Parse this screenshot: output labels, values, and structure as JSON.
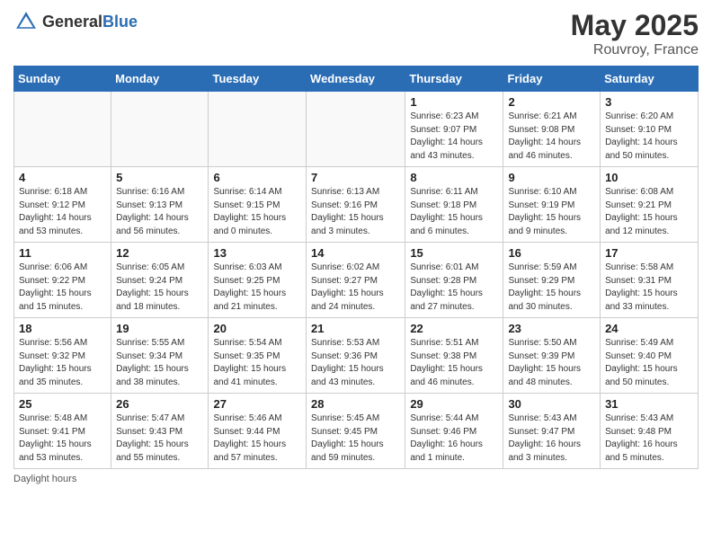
{
  "header": {
    "logo_general": "General",
    "logo_blue": "Blue",
    "main_title": "May 2025",
    "subtitle": "Rouvroy, France"
  },
  "weekdays": [
    "Sunday",
    "Monday",
    "Tuesday",
    "Wednesday",
    "Thursday",
    "Friday",
    "Saturday"
  ],
  "weeks": [
    [
      {
        "day": "",
        "info": ""
      },
      {
        "day": "",
        "info": ""
      },
      {
        "day": "",
        "info": ""
      },
      {
        "day": "",
        "info": ""
      },
      {
        "day": "1",
        "info": "Sunrise: 6:23 AM\nSunset: 9:07 PM\nDaylight: 14 hours and 43 minutes."
      },
      {
        "day": "2",
        "info": "Sunrise: 6:21 AM\nSunset: 9:08 PM\nDaylight: 14 hours and 46 minutes."
      },
      {
        "day": "3",
        "info": "Sunrise: 6:20 AM\nSunset: 9:10 PM\nDaylight: 14 hours and 50 minutes."
      }
    ],
    [
      {
        "day": "4",
        "info": "Sunrise: 6:18 AM\nSunset: 9:12 PM\nDaylight: 14 hours and 53 minutes."
      },
      {
        "day": "5",
        "info": "Sunrise: 6:16 AM\nSunset: 9:13 PM\nDaylight: 14 hours and 56 minutes."
      },
      {
        "day": "6",
        "info": "Sunrise: 6:14 AM\nSunset: 9:15 PM\nDaylight: 15 hours and 0 minutes."
      },
      {
        "day": "7",
        "info": "Sunrise: 6:13 AM\nSunset: 9:16 PM\nDaylight: 15 hours and 3 minutes."
      },
      {
        "day": "8",
        "info": "Sunrise: 6:11 AM\nSunset: 9:18 PM\nDaylight: 15 hours and 6 minutes."
      },
      {
        "day": "9",
        "info": "Sunrise: 6:10 AM\nSunset: 9:19 PM\nDaylight: 15 hours and 9 minutes."
      },
      {
        "day": "10",
        "info": "Sunrise: 6:08 AM\nSunset: 9:21 PM\nDaylight: 15 hours and 12 minutes."
      }
    ],
    [
      {
        "day": "11",
        "info": "Sunrise: 6:06 AM\nSunset: 9:22 PM\nDaylight: 15 hours and 15 minutes."
      },
      {
        "day": "12",
        "info": "Sunrise: 6:05 AM\nSunset: 9:24 PM\nDaylight: 15 hours and 18 minutes."
      },
      {
        "day": "13",
        "info": "Sunrise: 6:03 AM\nSunset: 9:25 PM\nDaylight: 15 hours and 21 minutes."
      },
      {
        "day": "14",
        "info": "Sunrise: 6:02 AM\nSunset: 9:27 PM\nDaylight: 15 hours and 24 minutes."
      },
      {
        "day": "15",
        "info": "Sunrise: 6:01 AM\nSunset: 9:28 PM\nDaylight: 15 hours and 27 minutes."
      },
      {
        "day": "16",
        "info": "Sunrise: 5:59 AM\nSunset: 9:29 PM\nDaylight: 15 hours and 30 minutes."
      },
      {
        "day": "17",
        "info": "Sunrise: 5:58 AM\nSunset: 9:31 PM\nDaylight: 15 hours and 33 minutes."
      }
    ],
    [
      {
        "day": "18",
        "info": "Sunrise: 5:56 AM\nSunset: 9:32 PM\nDaylight: 15 hours and 35 minutes."
      },
      {
        "day": "19",
        "info": "Sunrise: 5:55 AM\nSunset: 9:34 PM\nDaylight: 15 hours and 38 minutes."
      },
      {
        "day": "20",
        "info": "Sunrise: 5:54 AM\nSunset: 9:35 PM\nDaylight: 15 hours and 41 minutes."
      },
      {
        "day": "21",
        "info": "Sunrise: 5:53 AM\nSunset: 9:36 PM\nDaylight: 15 hours and 43 minutes."
      },
      {
        "day": "22",
        "info": "Sunrise: 5:51 AM\nSunset: 9:38 PM\nDaylight: 15 hours and 46 minutes."
      },
      {
        "day": "23",
        "info": "Sunrise: 5:50 AM\nSunset: 9:39 PM\nDaylight: 15 hours and 48 minutes."
      },
      {
        "day": "24",
        "info": "Sunrise: 5:49 AM\nSunset: 9:40 PM\nDaylight: 15 hours and 50 minutes."
      }
    ],
    [
      {
        "day": "25",
        "info": "Sunrise: 5:48 AM\nSunset: 9:41 PM\nDaylight: 15 hours and 53 minutes."
      },
      {
        "day": "26",
        "info": "Sunrise: 5:47 AM\nSunset: 9:43 PM\nDaylight: 15 hours and 55 minutes."
      },
      {
        "day": "27",
        "info": "Sunrise: 5:46 AM\nSunset: 9:44 PM\nDaylight: 15 hours and 57 minutes."
      },
      {
        "day": "28",
        "info": "Sunrise: 5:45 AM\nSunset: 9:45 PM\nDaylight: 15 hours and 59 minutes."
      },
      {
        "day": "29",
        "info": "Sunrise: 5:44 AM\nSunset: 9:46 PM\nDaylight: 16 hours and 1 minute."
      },
      {
        "day": "30",
        "info": "Sunrise: 5:43 AM\nSunset: 9:47 PM\nDaylight: 16 hours and 3 minutes."
      },
      {
        "day": "31",
        "info": "Sunrise: 5:43 AM\nSunset: 9:48 PM\nDaylight: 16 hours and 5 minutes."
      }
    ]
  ],
  "footer": {
    "note": "Daylight hours"
  }
}
